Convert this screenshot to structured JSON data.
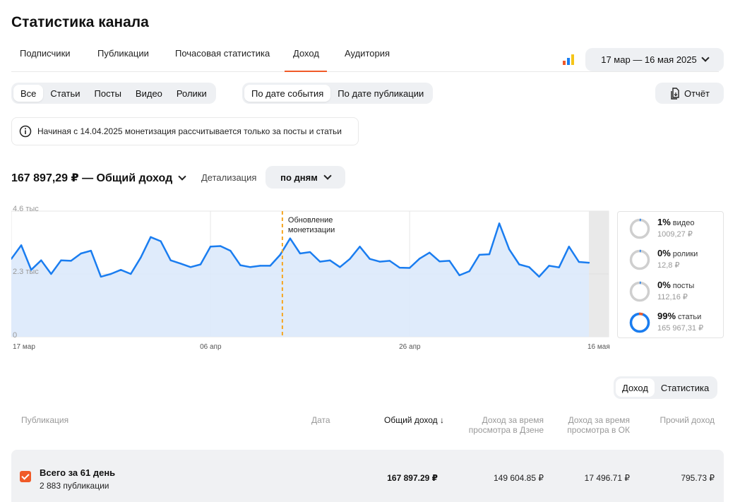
{
  "page": {
    "title": "Статистика канала"
  },
  "tabs": [
    {
      "label": "Подписчики"
    },
    {
      "label": "Публикации"
    },
    {
      "label": "Почасовая статистика"
    },
    {
      "label": "Доход",
      "active": true
    },
    {
      "label": "Аудитория"
    }
  ],
  "date_range": {
    "label": "17 мар — 16 мая 2025"
  },
  "content_filter": {
    "items": [
      "Все",
      "Статьи",
      "Посты",
      "Видео",
      "Ролики"
    ],
    "selected": "Все"
  },
  "date_mode": {
    "items": [
      "По дате события",
      "По дате публикации"
    ],
    "selected": "По дате события"
  },
  "report_button": {
    "label": "Отчёт"
  },
  "notice": {
    "text": "Начиная с 14.04.2025 монетизация рассчитывается только за посты и статьи"
  },
  "summary": {
    "total": "167 897,29 ₽ — Общий доход"
  },
  "detail": {
    "label": "Детализация",
    "value": "по дням"
  },
  "chart_data": {
    "type": "area",
    "x_ticks": [
      "17 мар",
      "06 апр",
      "26 апр",
      "16 мая"
    ],
    "y_ticks": [
      "4.6 тыс",
      "2.3 тыс",
      "0"
    ],
    "ylim": [
      0,
      4600
    ],
    "annotation": {
      "text_line1": "Обновление",
      "text_line2": "монетизации",
      "index": 28
    },
    "values": [
      2850,
      3350,
      2450,
      2800,
      2300,
      2800,
      2780,
      3050,
      3150,
      2200,
      2300,
      2450,
      2300,
      2900,
      3650,
      3500,
      2800,
      2680,
      2550,
      2650,
      3300,
      3320,
      3150,
      2620,
      2550,
      2600,
      2600,
      3000,
      3600,
      3050,
      3100,
      2750,
      2800,
      2550,
      2850,
      3300,
      2850,
      2750,
      2780,
      2530,
      2520,
      2860,
      3080,
      2760,
      2780,
      2250,
      2400,
      3000,
      3020,
      4150,
      3200,
      2650,
      2550,
      2200,
      2600,
      2540,
      3300,
      2740,
      2710
    ],
    "shaded_tail": true,
    "colors": {
      "line": "#1a7df0",
      "fill": "#dbe9fb",
      "annotation": "#f5a623",
      "tail": "#e9e9e9"
    }
  },
  "legend": [
    {
      "pct": "1%",
      "name": "видео",
      "value": "1009,27 ₽",
      "share": 0.01,
      "color": "#1a7df0"
    },
    {
      "pct": "0%",
      "name": "ролики",
      "value": "12,8 ₽",
      "share": 0.005,
      "color": "#1a7df0"
    },
    {
      "pct": "0%",
      "name": "посты",
      "value": "112,16 ₽",
      "share": 0.005,
      "color": "#1a7df0"
    },
    {
      "pct": "99%",
      "name": "статьи",
      "value": "165 967,31 ₽",
      "share": 0.99,
      "color": "#1a7df0",
      "accent": "#f05a28"
    }
  ],
  "view_toggle": {
    "items": [
      "Доход",
      "Статистика"
    ],
    "selected": "Доход"
  },
  "table": {
    "headers": {
      "publication": "Публикация",
      "date": "Дата",
      "total": "Общий доход",
      "dzen_1": "Доход за время",
      "dzen_2": "просмотра в Дзене",
      "ok_1": "Доход за время",
      "ok_2": "просмотра в ОК",
      "other": "Прочий доход"
    },
    "summary_row": {
      "title": "Всего за 61 день",
      "subtitle": "2 883 публикации",
      "total": "167 897.29 ₽",
      "dzen": "149 604.85 ₽",
      "ok": "17 496.71 ₽",
      "other": "795.73 ₽"
    }
  },
  "colors": {
    "accent": "#f05a28",
    "bg_button": "#eef0f3",
    "brand_blue": "#1a7df0"
  }
}
